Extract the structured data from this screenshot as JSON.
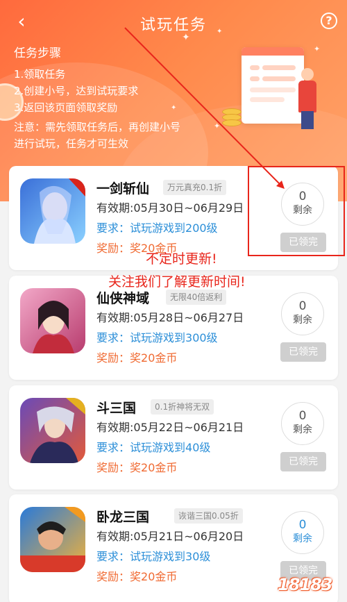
{
  "header": {
    "title": "试玩任务",
    "back_icon": "‹",
    "help_icon": "?"
  },
  "steps": {
    "title": "任务步骤",
    "items": [
      "1.领取任务",
      "2.创建小号，达到试玩要求",
      "3.返回该页面领取奖励"
    ],
    "note_line1": "注意：需先领取任务后，再创建小号",
    "note_line2": "进行试玩，任务才可生效"
  },
  "tasks": [
    {
      "name": "一剑斩仙",
      "tag": "万元真充0.1折",
      "validity": "有效期:05月30日~06月29日",
      "requirement_label": "要求：",
      "requirement": "试玩游戏到200级",
      "reward_label": "奖励：",
      "reward": "奖20金币",
      "remaining_count": "0",
      "remaining_label": "剩余",
      "button": "已领完"
    },
    {
      "name": "仙侠神域",
      "tag": "无限40倍返利",
      "validity": "有效期:05月28日~06月27日",
      "requirement_label": "要求：",
      "requirement": "试玩游戏到300级",
      "reward_label": "奖励：",
      "reward": "奖20金币",
      "remaining_count": "0",
      "remaining_label": "剩余",
      "button": "已领完"
    },
    {
      "name": "斗三国",
      "tag": "0.1折神将无双",
      "validity": "有效期:05月22日~06月21日",
      "requirement_label": "要求：",
      "requirement": "试玩游戏到40级",
      "reward_label": "奖励：",
      "reward": "奖20金币",
      "remaining_count": "0",
      "remaining_label": "剩余",
      "button": "已领完"
    },
    {
      "name": "卧龙三国",
      "tag": "诙谐三国0.05折",
      "validity": "有效期:05月21日~06月20日",
      "requirement_label": "要求：",
      "requirement": "试玩游戏到30级",
      "reward_label": "奖励：",
      "reward": "奖20金币",
      "remaining_count": "0",
      "remaining_label": "剩余",
      "button": "已领完"
    }
  ],
  "annotation": {
    "line1": "不定时更新!",
    "line2": "关注我们了解更新时间!"
  },
  "watermark": "18183",
  "colors": {
    "header_orange": "#ff6a3d",
    "requirement_blue": "#2c8fd8",
    "reward_orange": "#f06a32",
    "annotation_red": "#e8251b"
  }
}
